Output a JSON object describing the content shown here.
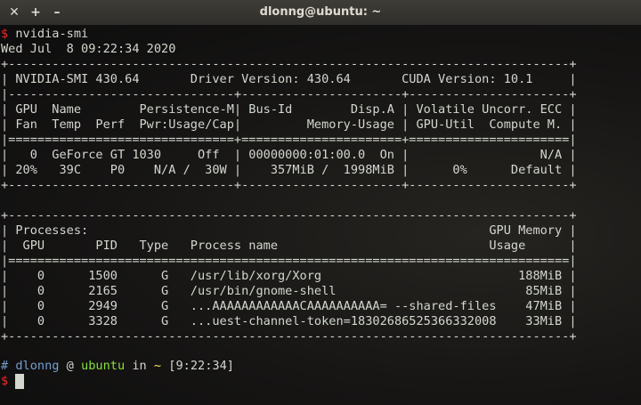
{
  "window": {
    "title": "dlonng@ubuntu: ~",
    "buttons": {
      "close": "✕",
      "new_tab": "+",
      "minimize": "–"
    }
  },
  "terminal": {
    "prompt_symbol": "$",
    "command": " nvidia-smi",
    "date": "Wed Jul  8 09:22:34 2020",
    "smi": [
      "+-----------------------------------------------------------------------------+",
      "| NVIDIA-SMI 430.64       Driver Version: 430.64       CUDA Version: 10.1     |",
      "|-------------------------------+----------------------+----------------------+",
      "| GPU  Name        Persistence-M| Bus-Id        Disp.A | Volatile Uncorr. ECC |",
      "| Fan  Temp  Perf  Pwr:Usage/Cap|         Memory-Usage | GPU-Util  Compute M. |",
      "|===============================+======================+======================|",
      "|   0  GeForce GT 1030     Off  | 00000000:01:00.0  On |                  N/A |",
      "| 20%   39C    P0    N/A /  30W |    357MiB /  1998MiB |      0%      Default |",
      "+-------------------------------+----------------------+----------------------+",
      "",
      "+-----------------------------------------------------------------------------+",
      "| Processes:                                                       GPU Memory |",
      "|  GPU       PID   Type   Process name                             Usage      |",
      "|=============================================================================|",
      "|    0      1500      G   /usr/lib/xorg/Xorg                           188MiB |",
      "|    0      2165      G   /usr/bin/gnome-shell                          85MiB |",
      "|    0      2949      G   ...AAAAAAAAAAAACAAAAAAAAAA= --shared-files    47MiB |",
      "|    0      3328      G   ...uest-channel-token=18302686525366332008    33MiB |",
      "+-----------------------------------------------------------------------------+"
    ],
    "status": {
      "hash": "#",
      "user": "dlonng",
      "at": "@",
      "host": "ubuntu",
      "in": "in",
      "dir": "~",
      "time": "[9:22:34]"
    },
    "colors": {
      "prompt": "#ef2929",
      "user": "#729fcf",
      "host": "#8ae234",
      "dir": "#fce94f",
      "text": "#d3d7cf"
    }
  }
}
